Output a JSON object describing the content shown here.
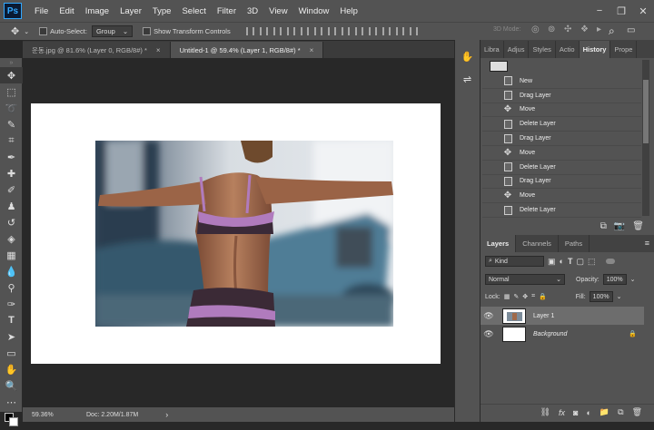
{
  "app": {
    "logo": "Ps"
  },
  "menu": [
    "File",
    "Edit",
    "Image",
    "Layer",
    "Type",
    "Select",
    "Filter",
    "3D",
    "View",
    "Window",
    "Help"
  ],
  "window_controls": [
    "−",
    "❐",
    "✕"
  ],
  "options": {
    "auto_select": "Auto-Select:",
    "group_value": "Group",
    "show_transform": "Show Transform Controls",
    "mode_3d": "3D Mode:"
  },
  "tabs": [
    {
      "label": "운동.jpg @ 81.6% (Layer 0, RGB/8#) *",
      "close": "×"
    },
    {
      "label": "Untitled-1 @ 59.4% (Layer 1, RGB/8#) *",
      "close": "×"
    }
  ],
  "status": {
    "zoom": "59.36%",
    "doc": "Doc: 2.20M/1.87M",
    "arrow": "›"
  },
  "panel_tabs": [
    "Libra",
    "Adjus",
    "Styles",
    "Actio",
    "History",
    "Prope"
  ],
  "history": [
    "New",
    "Drag Layer",
    "Move",
    "Delete Layer",
    "Drag Layer",
    "Move",
    "Delete Layer",
    "Drag Layer",
    "Move",
    "Delete Layer"
  ],
  "history_icons": [
    "doc",
    "doc",
    "move",
    "doc",
    "doc",
    "move",
    "doc",
    "doc",
    "move",
    "doc"
  ],
  "layers_tabs": [
    "Layers",
    "Channels",
    "Paths"
  ],
  "layers_ctl": {
    "kind": "Kind",
    "blend": "Normal",
    "opacity_label": "Opacity:",
    "opacity": "100%",
    "lock_label": "Lock:",
    "fill_label": "Fill:",
    "fill": "100%"
  },
  "layers": [
    {
      "name": "Layer 1",
      "selected": true,
      "italic": false
    },
    {
      "name": "Background",
      "selected": false,
      "italic": true,
      "lock": "🔒"
    }
  ]
}
